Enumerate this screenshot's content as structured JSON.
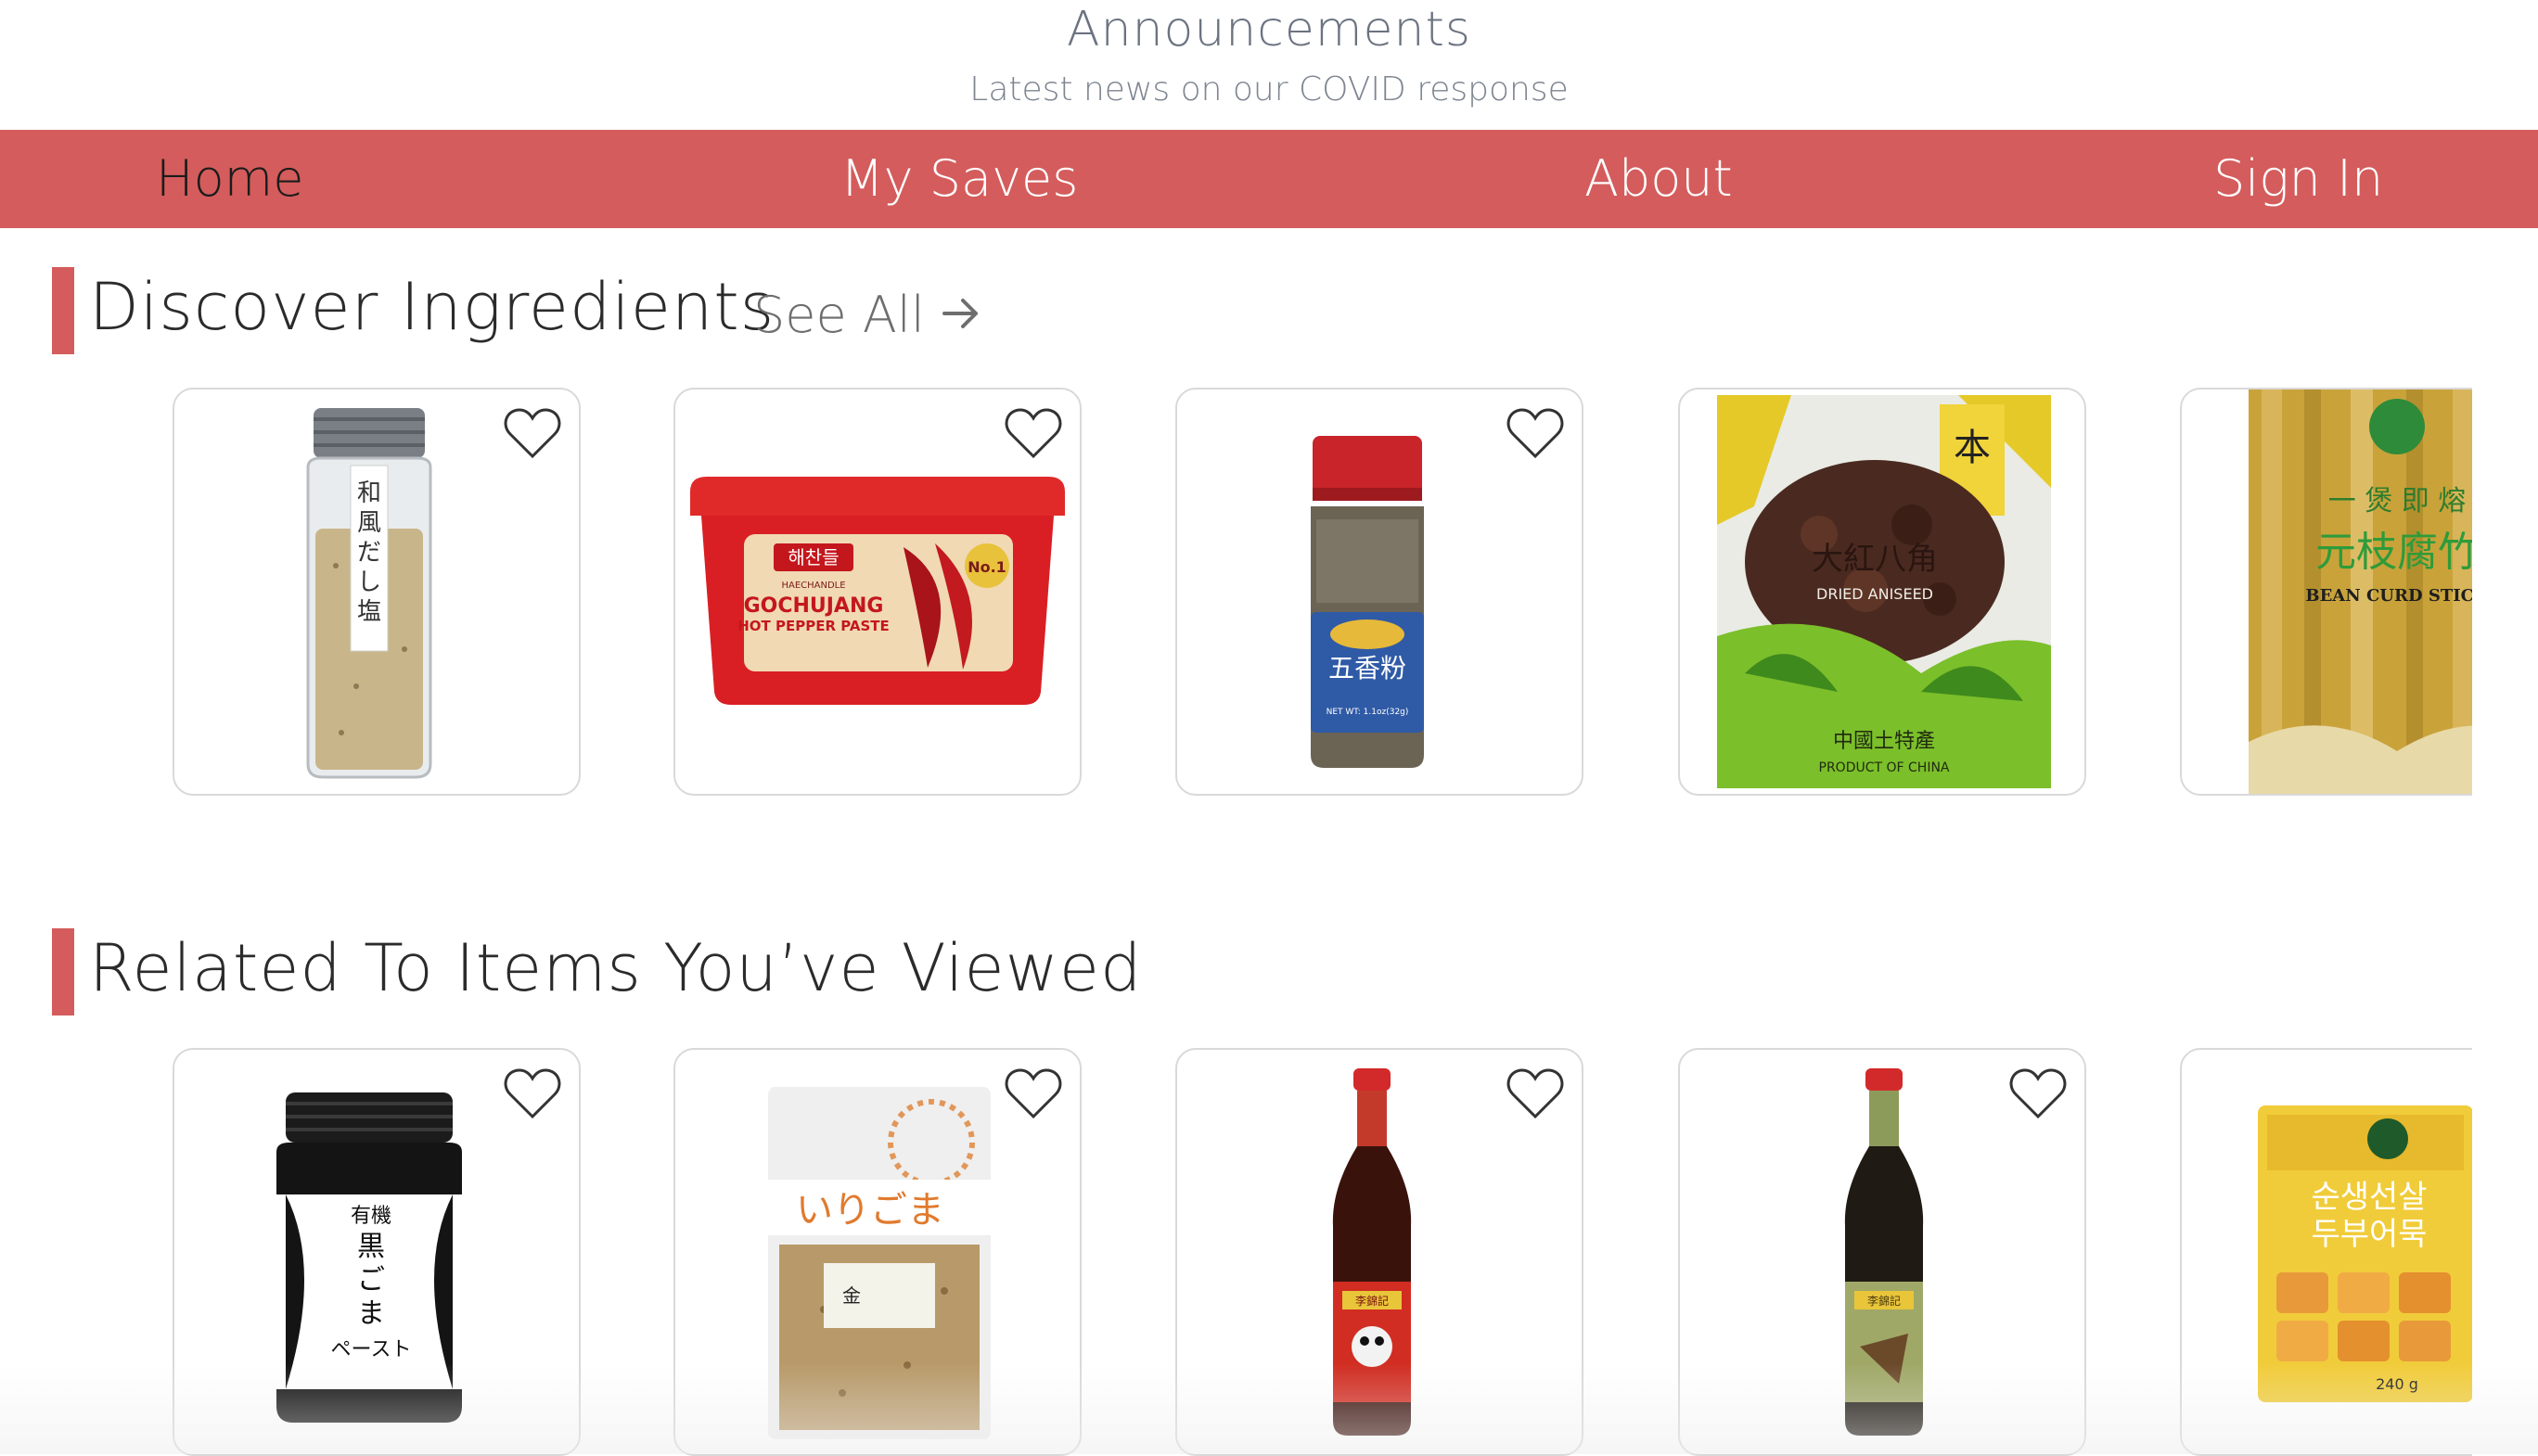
{
  "announcement": {
    "title": "Announcements",
    "subtitle": "Latest news on our COVID response"
  },
  "nav": {
    "items": [
      {
        "label": "Home",
        "active": true
      },
      {
        "label": "My Saves",
        "active": false
      },
      {
        "label": "About",
        "active": false
      },
      {
        "label": "Sign  In",
        "active": false
      }
    ]
  },
  "sections": {
    "discover": {
      "title": "Discover  Ingredients",
      "see_all": "See All",
      "see_all_icon": "arrow-right-icon",
      "products": [
        {
          "name": "dashi-salt-jar",
          "label": "和風だし塩"
        },
        {
          "name": "gochujang-tub",
          "brand": "해찬들",
          "brand_en": "HAECHANDLE",
          "label": "GOCHUJANG",
          "sub": "HOT PEPPER PASTE",
          "badge": "No.1"
        },
        {
          "name": "five-spice-jar",
          "label": "五香粉"
        },
        {
          "name": "dried-aniseed-bag",
          "label": "大紅八角",
          "sub": "DRIED ANISEED",
          "footer": "PRODUCT OF CHINA"
        },
        {
          "name": "bean-curd-stick-bag",
          "label": "元枝腐竹",
          "sub": "BEAN CURD STICK"
        }
      ]
    },
    "related": {
      "title": "Related To  Items You’ve Viewed",
      "products": [
        {
          "name": "black-sesame-paste-jar",
          "label": "黒ごまペースト",
          "sub": "有機"
        },
        {
          "name": "roasted-sesame-bag",
          "label": "いりごま",
          "tag": "金"
        },
        {
          "name": "oyster-sauce-bottle",
          "label": "李錦記"
        },
        {
          "name": "marinade-bottle",
          "label": "李錦記"
        },
        {
          "name": "fish-cake-pack",
          "label": "순생선살",
          "sub": "두부어묵",
          "weight": "240 g"
        }
      ]
    }
  },
  "colors": {
    "accent": "#d45c5c",
    "nav_text": "#ffffff",
    "nav_active_text": "#1b1b1b",
    "card_border": "#d9d9d9"
  }
}
